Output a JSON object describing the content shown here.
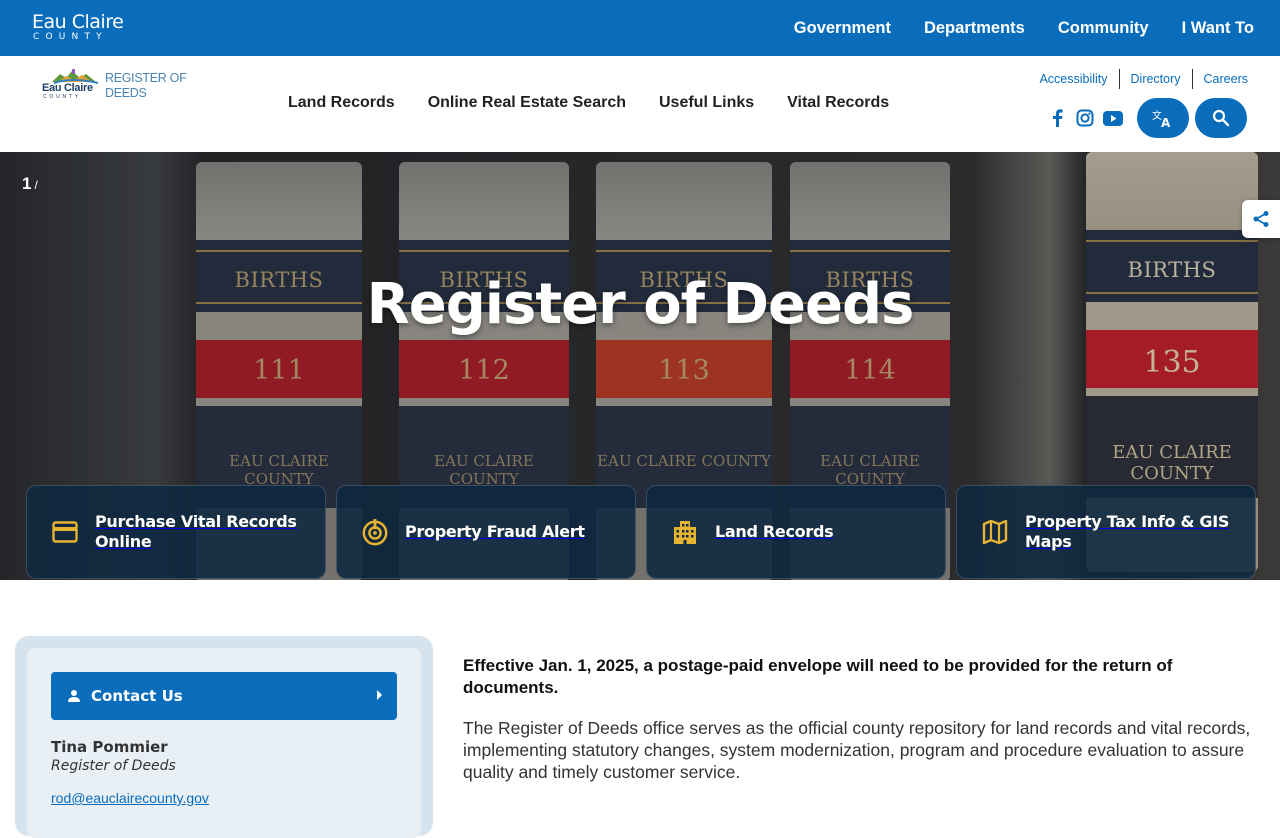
{
  "county": {
    "name_line1": "Eau Claire",
    "name_line2": "COUNTY"
  },
  "top_nav": [
    "Government",
    "Departments",
    "Community",
    "I Want To"
  ],
  "dept_logo": {
    "county_line1": "Eau Claire",
    "county_line2": "COUNTY",
    "title_line1": "REGISTER OF",
    "title_line2": "DEEDS"
  },
  "main_nav": [
    "Land Records",
    "Online Real Estate Search",
    "Useful Links",
    "Vital Records"
  ],
  "utility_links": [
    "Accessibility",
    "Directory",
    "Careers"
  ],
  "social_icons": [
    "facebook-icon",
    "instagram-icon",
    "youtube-icon"
  ],
  "hero": {
    "slide_current": "1",
    "slide_separator": "/",
    "title": "Register of Deeds",
    "books": [
      {
        "label": "BIRTHS",
        "volume": "111",
        "county": "EAU CLAIRE COUNTY"
      },
      {
        "label": "BIRTHS",
        "volume": "112",
        "county": "EAU CLAIRE COUNTY"
      },
      {
        "label": "BIRTHS",
        "volume": "113",
        "county": "EAU CLAIRE COUNTY"
      },
      {
        "label": "BIRTHS",
        "volume": "114",
        "county": "EAU CLAIRE COUNTY"
      },
      {
        "label": "BIRTHS",
        "volume": "135",
        "county": "EAU CLAIRE COUNTY"
      }
    ]
  },
  "quick_links": [
    {
      "label": "Purchase Vital Records Online",
      "icon": "credit-card-icon"
    },
    {
      "label": "Property Fraud Alert",
      "icon": "alert-target-icon"
    },
    {
      "label": "Land Records",
      "icon": "building-icon"
    },
    {
      "label": "Property Tax Info & GIS Maps",
      "icon": "map-icon"
    }
  ],
  "colors": {
    "brand_blue": "#0a6dbb",
    "tile_icon_gold": "#e7b432",
    "tile_bg": "#0e2840"
  },
  "contact": {
    "button_label": "Contact Us",
    "name": "Tina Pommier",
    "title": "Register of Deeds",
    "email": "rod@eauclairecounty.gov"
  },
  "main": {
    "notice": "Effective Jan. 1, 2025, a postage-paid envelope will need to be provided for the return of documents.",
    "intro": "The Register of Deeds office serves as the official county repository for land records and vital records, implementing statutory changes, system modernization, program and procedure evaluation to assure quality and timely customer service."
  }
}
